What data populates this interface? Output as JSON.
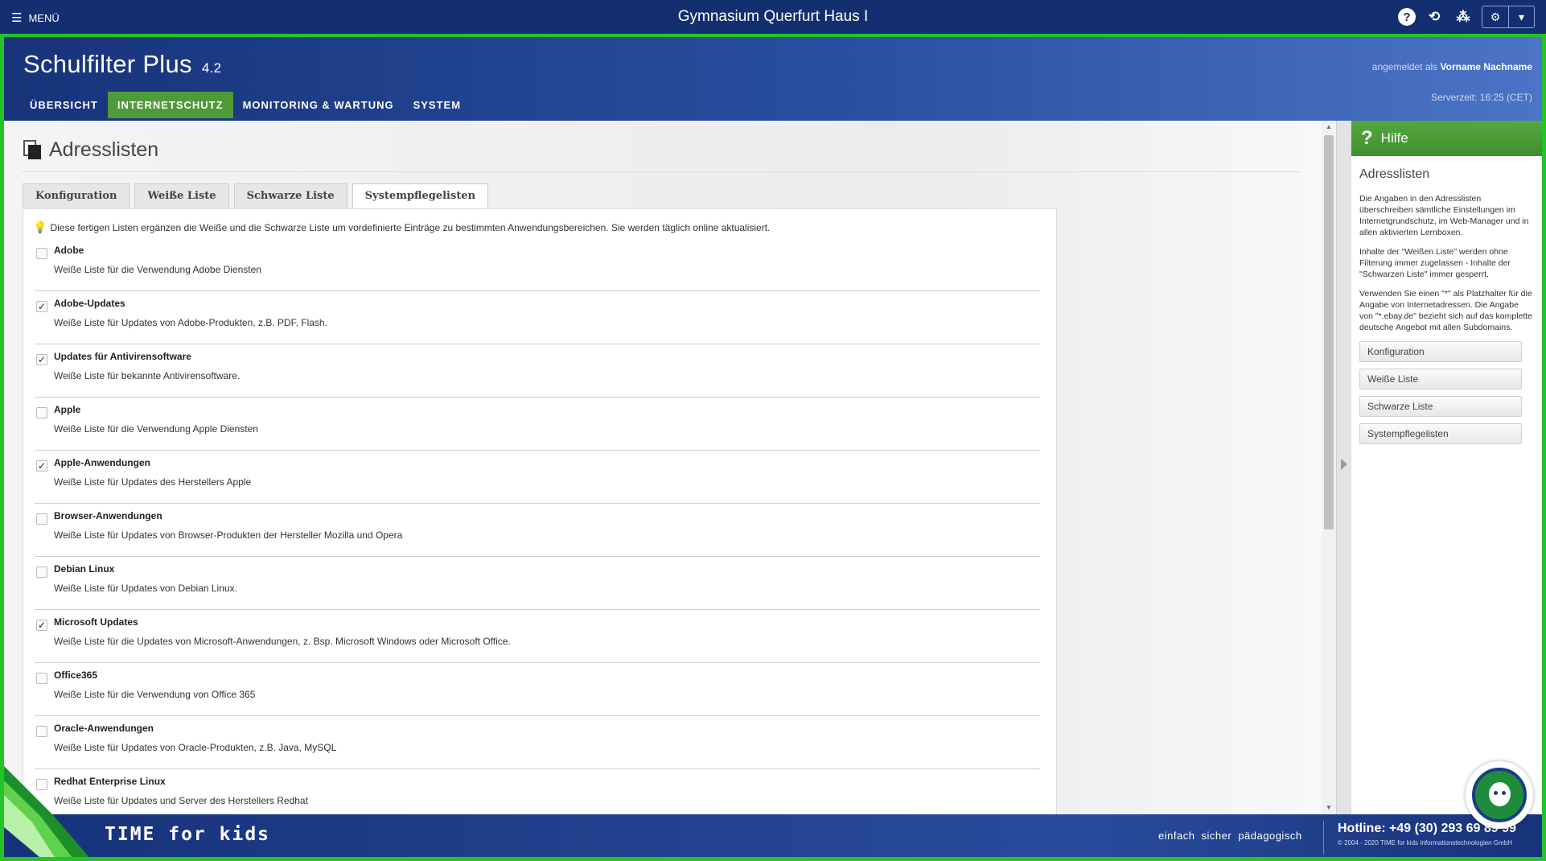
{
  "topbar": {
    "menu_label": "MENÜ",
    "title": "Gymnasium Querfurt Haus I",
    "icons": [
      "help-icon",
      "history-icon",
      "network-icon",
      "gear-icon",
      "caret-down-icon"
    ]
  },
  "header": {
    "app_name": "Schulfilter Plus",
    "version": "4.2",
    "logged_in_prefix": "angemeldet als",
    "user_name": "Vorname Nachname",
    "server_time": "Serverzeit: 16:25 (CET)",
    "nav": [
      {
        "label": "ÜBERSICHT",
        "active": false
      },
      {
        "label": "INTERNETSCHUTZ",
        "active": true
      },
      {
        "label": "MONITORING & WARTUNG",
        "active": false
      },
      {
        "label": "SYSTEM",
        "active": false
      }
    ]
  },
  "page": {
    "title": "Adresslisten",
    "tabs": [
      {
        "label": "Konfiguration",
        "active": false
      },
      {
        "label": "Weiße Liste",
        "active": false
      },
      {
        "label": "Schwarze Liste",
        "active": false
      },
      {
        "label": "Systempflegelisten",
        "active": true
      }
    ],
    "intro": "Diese fertigen Listen ergänzen die Weiße und die Schwarze Liste um vordefinierte Einträge zu bestimmten Anwendungsbereichen. Sie werden täglich online aktualisiert.",
    "items": [
      {
        "name": "Adobe",
        "desc": "Weiße Liste für die Verwendung Adobe Diensten",
        "checked": false
      },
      {
        "name": "Adobe-Updates",
        "desc": "Weiße Liste für Updates von Adobe-Produkten, z.B. PDF, Flash.",
        "checked": true
      },
      {
        "name": "Updates für Antivirensoftware",
        "desc": "Weiße Liste für bekannte Antivirensoftware.",
        "checked": true
      },
      {
        "name": "Apple",
        "desc": "Weiße Liste für die Verwendung Apple Diensten",
        "checked": false
      },
      {
        "name": "Apple-Anwendungen",
        "desc": "Weiße Liste für Updates des Herstellers Apple",
        "checked": true
      },
      {
        "name": "Browser-Anwendungen",
        "desc": "Weiße Liste für Updates von Browser-Produkten der Hersteller Mozilla und Opera",
        "checked": false
      },
      {
        "name": "Debian Linux",
        "desc": "Weiße Liste für Updates von Debian Linux.",
        "checked": false
      },
      {
        "name": "Microsoft Updates",
        "desc": "Weiße Liste für die Updates von Microsoft-Anwendungen, z. Bsp. Microsoft Windows oder Microsoft Office.",
        "checked": true
      },
      {
        "name": "Office365",
        "desc": "Weiße Liste für die Verwendung von Office 365",
        "checked": false
      },
      {
        "name": "Oracle-Anwendungen",
        "desc": "Weiße Liste für Updates von Oracle-Produkten, z.B. Java, MySQL",
        "checked": false
      },
      {
        "name": "Redhat Enterprise Linux",
        "desc": "Weiße Liste für Updates und Server des Herstellers Redhat",
        "checked": false
      }
    ]
  },
  "help": {
    "header": "Hilfe",
    "title": "Adresslisten",
    "paragraphs": [
      "Die Angaben in den Adresslisten überschreiben sämtliche Einstellungen im Internetgrundschutz, im Web-Manager und in allen aktivierten Lernboxen.",
      "Inhalte der \"Weißen Liste\" werden ohne Filterung immer zugelassen - Inhalte der \"Schwarzen Liste\" immer gesperrt.",
      "Verwenden Sie einen \"*\" als Platzhalter für die Angabe von Internetadressen. Die Angabe von \"*.ebay.de\" bezieht sich auf das komplette deutsche Angebot mit allen Subdomains."
    ],
    "buttons": [
      "Konfiguration",
      "Weiße Liste",
      "Schwarze Liste",
      "Systempflegelisten"
    ]
  },
  "footer": {
    "brand": "TIME for kids",
    "tagline": "einfach sicher pädagogisch",
    "hotline": "Hotline: +49 (30) 293 69 89 99",
    "copyright": "© 2004 - 2020 TIME for kids Informationstechnologien GmbH"
  },
  "colors": {
    "frame": "#22c42a",
    "active_tab_green": "#4f9a39",
    "header_blue": "#17337a"
  }
}
